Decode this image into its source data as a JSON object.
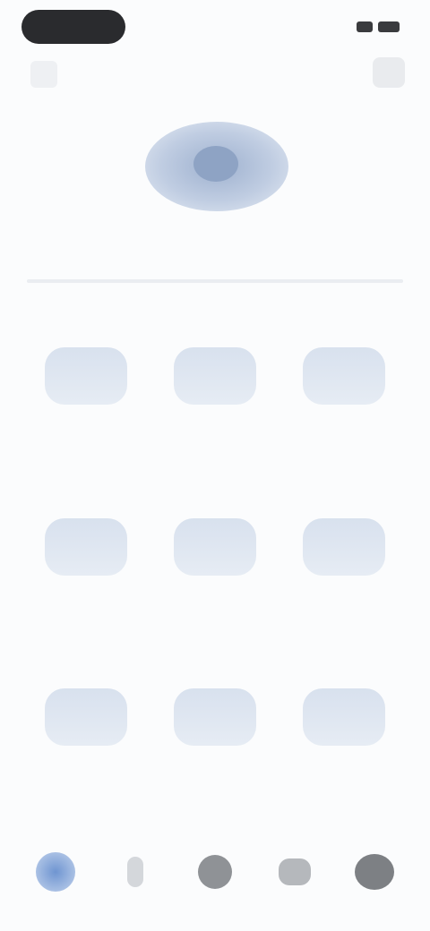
{
  "header": {
    "title": "",
    "back_icon": "back-icon",
    "menu_icon": "menu-icon"
  },
  "profile": {
    "name": "",
    "avatar_icon": "avatar-icon"
  },
  "grid": {
    "tiles": [
      {
        "label": ""
      },
      {
        "label": ""
      },
      {
        "label": ""
      },
      {
        "label": ""
      },
      {
        "label": ""
      },
      {
        "label": ""
      },
      {
        "label": ""
      },
      {
        "label": ""
      },
      {
        "label": ""
      }
    ]
  },
  "bottom_nav": {
    "items": [
      {
        "icon": "home-icon",
        "active": true
      },
      {
        "icon": "person-icon"
      },
      {
        "icon": "camera-icon"
      },
      {
        "icon": "chat-icon"
      },
      {
        "icon": "settings-icon"
      }
    ]
  },
  "colors": {
    "accent": "#6f95d1",
    "tile": "#dfe6f0"
  }
}
